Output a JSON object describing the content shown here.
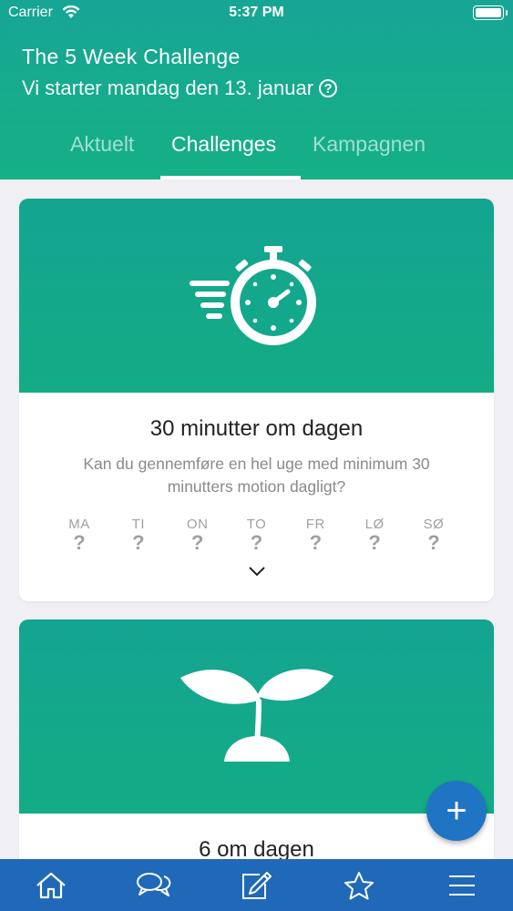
{
  "status_bar": {
    "carrier": "Carrier",
    "time": "5:37 PM"
  },
  "header": {
    "title": "The 5 Week Challenge",
    "subtitle": "Vi starter mandag den 13. januar"
  },
  "tabs": [
    {
      "label": "Aktuelt",
      "active": false
    },
    {
      "label": "Challenges",
      "active": true
    },
    {
      "label": "Kampagnen",
      "active": false
    }
  ],
  "cards": [
    {
      "icon": "stopwatch-icon",
      "title": "30 minutter om dagen",
      "description": "Kan du gennemføre en hel uge med minimum 30 minutters motion dagligt?",
      "days": [
        {
          "label": "MA",
          "status": "?"
        },
        {
          "label": "TI",
          "status": "?"
        },
        {
          "label": "ON",
          "status": "?"
        },
        {
          "label": "TO",
          "status": "?"
        },
        {
          "label": "FR",
          "status": "?"
        },
        {
          "label": "LØ",
          "status": "?"
        },
        {
          "label": "SØ",
          "status": "?"
        }
      ]
    },
    {
      "icon": "sprout-icon",
      "title": "6 om dagen"
    }
  ],
  "fab": {
    "label": "+"
  },
  "bottom_nav": [
    {
      "icon": "home-icon"
    },
    {
      "icon": "chat-icon"
    },
    {
      "icon": "edit-icon"
    },
    {
      "icon": "star-icon"
    },
    {
      "icon": "menu-icon"
    }
  ],
  "colors": {
    "header_green": "#17a595",
    "hero_green": "#14a491",
    "nav_blue": "#1f69b8",
    "fab_blue": "#1f74c4",
    "background": "#efeff4"
  }
}
